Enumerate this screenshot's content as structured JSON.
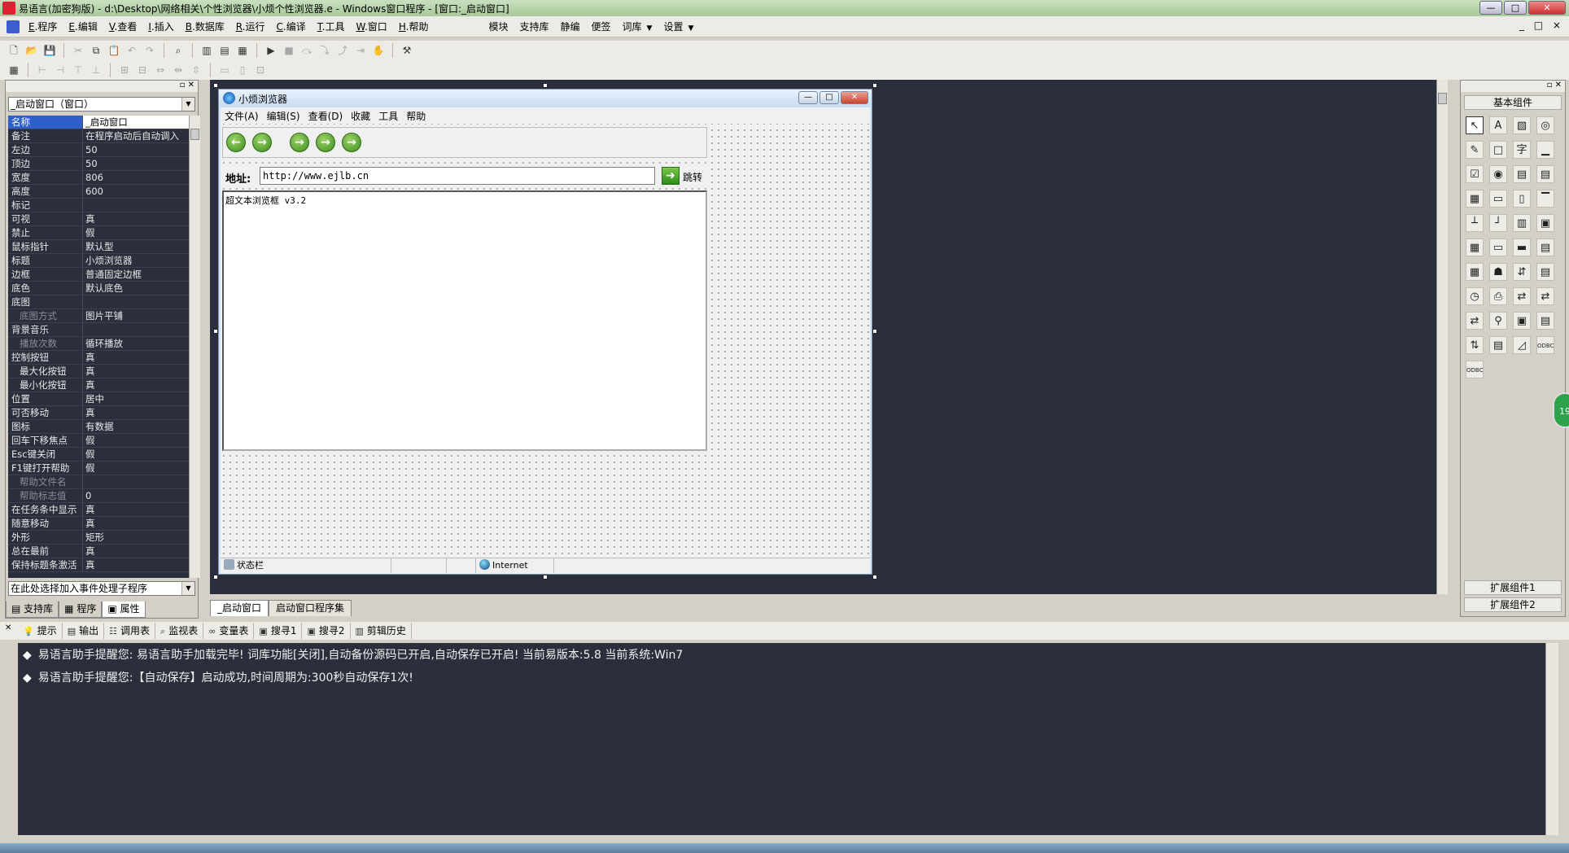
{
  "titlebar": {
    "title": "易语言(加密狗版) - d:\\Desktop\\网络相关\\个性浏览器\\小烦个性浏览器.e - Windows窗口程序 - [窗口:_启动窗口]",
    "buttons": [
      "—",
      "□",
      "✕"
    ]
  },
  "menubar": {
    "items": [
      {
        "key": "E",
        "label": ".程序"
      },
      {
        "key": "E",
        "label": ".编辑"
      },
      {
        "key": "V",
        "label": ".查看"
      },
      {
        "key": "I",
        "label": ".插入"
      },
      {
        "key": "B",
        "label": ".数据库"
      },
      {
        "key": "R",
        "label": ".运行"
      },
      {
        "key": "C",
        "label": ".编译"
      },
      {
        "key": "T",
        "label": ".工具"
      },
      {
        "key": "W",
        "label": ".窗口"
      },
      {
        "key": "H",
        "label": ".帮助"
      }
    ],
    "extra": [
      "模块",
      "支持库",
      "静编",
      "便签",
      "词库",
      "设置"
    ],
    "mdi_controls": "_ □ ×"
  },
  "properties": {
    "object_select": "_启动窗口（窗口）",
    "rows": [
      {
        "k": "名称",
        "v": "_启动窗口",
        "sel": true
      },
      {
        "k": "备注",
        "v": "在程序启动后自动调入"
      },
      {
        "k": "左边",
        "v": "50"
      },
      {
        "k": "顶边",
        "v": "50"
      },
      {
        "k": "宽度",
        "v": "806"
      },
      {
        "k": "高度",
        "v": "600"
      },
      {
        "k": "标记",
        "v": ""
      },
      {
        "k": "可视",
        "v": "真"
      },
      {
        "k": "禁止",
        "v": "假"
      },
      {
        "k": "鼠标指针",
        "v": "默认型"
      },
      {
        "k": "标题",
        "v": "小烦浏览器"
      },
      {
        "k": "边框",
        "v": "普通固定边框"
      },
      {
        "k": "底色",
        "v": "默认底色"
      },
      {
        "k": "底图",
        "v": ""
      },
      {
        "k": "底图方式",
        "v": "图片平铺",
        "sub": true
      },
      {
        "k": "背景音乐",
        "v": ""
      },
      {
        "k": "播放次数",
        "v": "循环播放",
        "sub": true
      },
      {
        "k": "控制按钮",
        "v": "真"
      },
      {
        "k": "最大化按钮",
        "v": "真",
        "sub2": true
      },
      {
        "k": "最小化按钮",
        "v": "真",
        "sub2": true
      },
      {
        "k": "位置",
        "v": "居中"
      },
      {
        "k": "可否移动",
        "v": "真"
      },
      {
        "k": "图标",
        "v": "有数据"
      },
      {
        "k": "回车下移焦点",
        "v": "假"
      },
      {
        "k": "Esc键关闭",
        "v": "假"
      },
      {
        "k": "F1键打开帮助",
        "v": "假"
      },
      {
        "k": "帮助文件名",
        "v": "",
        "sub": true
      },
      {
        "k": "帮助标志值",
        "v": "0",
        "sub": true
      },
      {
        "k": "在任务条中显示",
        "v": "真"
      },
      {
        "k": "随意移动",
        "v": "真"
      },
      {
        "k": "外形",
        "v": "矩形"
      },
      {
        "k": "总在最前",
        "v": "真"
      },
      {
        "k": "保持标题条激活",
        "v": "真"
      }
    ],
    "event_select": "在此处选择加入事件处理子程序",
    "tabs": [
      "支持库",
      "程序",
      "属性"
    ]
  },
  "mockwin": {
    "title": "小烦浏览器",
    "menu": [
      "文件(A)",
      "编辑(S)",
      "查看(D)",
      "收藏",
      "工具",
      "帮助"
    ],
    "address_label": "地址:",
    "address_value": "http://www.ejlb.cn",
    "go_label": "跳转",
    "browser_text": "超文本浏览框 v3.2",
    "status_text": "状态栏",
    "status_zone": "Internet"
  },
  "components": {
    "title": "基本组件",
    "ext1": "扩展组件1",
    "ext2": "扩展组件2"
  },
  "editor_tabs": [
    "_启动窗口",
    "启动窗口程序集"
  ],
  "output_tabs": [
    "提示",
    "输出",
    "调用表",
    "监视表",
    "变量表",
    "搜寻1",
    "搜寻2",
    "剪辑历史"
  ],
  "output_lines": [
    "易语言助手提醒您:   易语言助手加载完毕!  词库功能[关闭],自动备份源码已开启,自动保存已开启!  当前易版本:5.8  当前系统:Win7",
    "易语言助手提醒您:【自动保存】启动成功,时间周期为:300秒自动保存1次!"
  ],
  "side_badge": "19"
}
